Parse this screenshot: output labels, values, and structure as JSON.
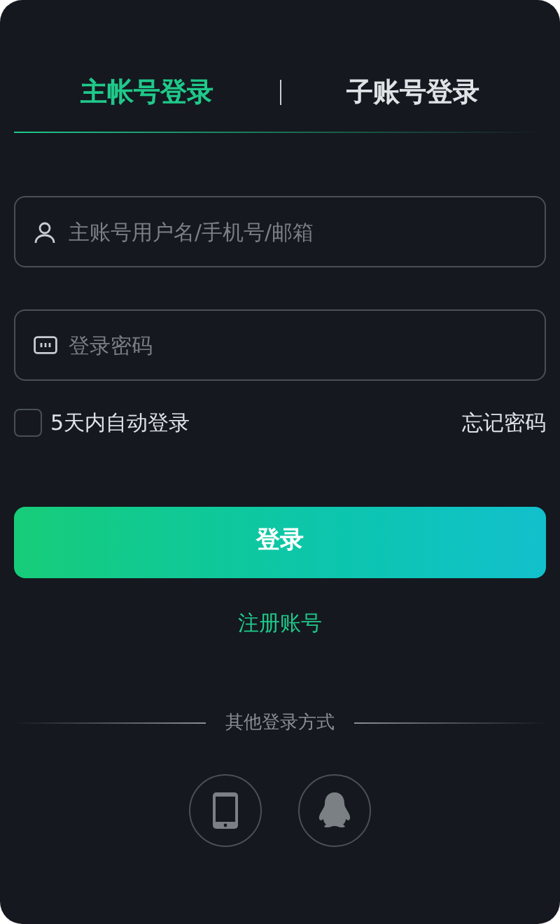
{
  "tabs": [
    {
      "label": "主帐号登录",
      "selected": true
    },
    {
      "label": "子账号登录",
      "selected": false
    }
  ],
  "fields": [
    {
      "kind": "user",
      "placeholder": "主账号用户名/手机号/邮箱"
    },
    {
      "kind": "password",
      "placeholder": "登录密码"
    }
  ],
  "remember": {
    "label": "5天内自动登录",
    "checked": false
  },
  "forgot": "忘记密码",
  "submit": "登录",
  "register": "注册账号",
  "other_title": "其他登录方式",
  "other_logins": [
    {
      "kind": "phone"
    },
    {
      "kind": "penguin"
    }
  ]
}
